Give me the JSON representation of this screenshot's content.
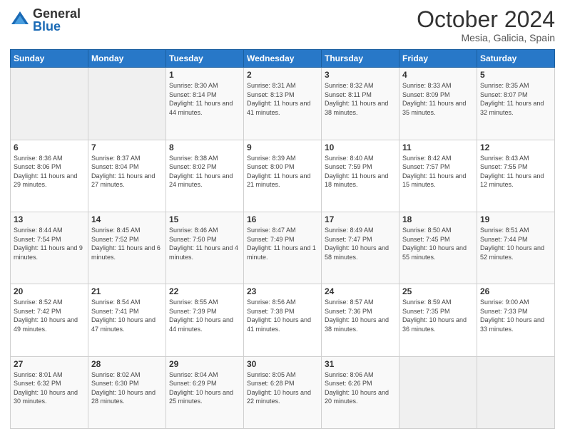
{
  "header": {
    "logo_general": "General",
    "logo_blue": "Blue",
    "month": "October 2024",
    "location": "Mesia, Galicia, Spain"
  },
  "weekdays": [
    "Sunday",
    "Monday",
    "Tuesday",
    "Wednesday",
    "Thursday",
    "Friday",
    "Saturday"
  ],
  "weeks": [
    [
      {
        "day": "",
        "sunrise": "",
        "sunset": "",
        "daylight": ""
      },
      {
        "day": "",
        "sunrise": "",
        "sunset": "",
        "daylight": ""
      },
      {
        "day": "1",
        "sunrise": "Sunrise: 8:30 AM",
        "sunset": "Sunset: 8:14 PM",
        "daylight": "Daylight: 11 hours and 44 minutes."
      },
      {
        "day": "2",
        "sunrise": "Sunrise: 8:31 AM",
        "sunset": "Sunset: 8:13 PM",
        "daylight": "Daylight: 11 hours and 41 minutes."
      },
      {
        "day": "3",
        "sunrise": "Sunrise: 8:32 AM",
        "sunset": "Sunset: 8:11 PM",
        "daylight": "Daylight: 11 hours and 38 minutes."
      },
      {
        "day": "4",
        "sunrise": "Sunrise: 8:33 AM",
        "sunset": "Sunset: 8:09 PM",
        "daylight": "Daylight: 11 hours and 35 minutes."
      },
      {
        "day": "5",
        "sunrise": "Sunrise: 8:35 AM",
        "sunset": "Sunset: 8:07 PM",
        "daylight": "Daylight: 11 hours and 32 minutes."
      }
    ],
    [
      {
        "day": "6",
        "sunrise": "Sunrise: 8:36 AM",
        "sunset": "Sunset: 8:06 PM",
        "daylight": "Daylight: 11 hours and 29 minutes."
      },
      {
        "day": "7",
        "sunrise": "Sunrise: 8:37 AM",
        "sunset": "Sunset: 8:04 PM",
        "daylight": "Daylight: 11 hours and 27 minutes."
      },
      {
        "day": "8",
        "sunrise": "Sunrise: 8:38 AM",
        "sunset": "Sunset: 8:02 PM",
        "daylight": "Daylight: 11 hours and 24 minutes."
      },
      {
        "day": "9",
        "sunrise": "Sunrise: 8:39 AM",
        "sunset": "Sunset: 8:00 PM",
        "daylight": "Daylight: 11 hours and 21 minutes."
      },
      {
        "day": "10",
        "sunrise": "Sunrise: 8:40 AM",
        "sunset": "Sunset: 7:59 PM",
        "daylight": "Daylight: 11 hours and 18 minutes."
      },
      {
        "day": "11",
        "sunrise": "Sunrise: 8:42 AM",
        "sunset": "Sunset: 7:57 PM",
        "daylight": "Daylight: 11 hours and 15 minutes."
      },
      {
        "day": "12",
        "sunrise": "Sunrise: 8:43 AM",
        "sunset": "Sunset: 7:55 PM",
        "daylight": "Daylight: 11 hours and 12 minutes."
      }
    ],
    [
      {
        "day": "13",
        "sunrise": "Sunrise: 8:44 AM",
        "sunset": "Sunset: 7:54 PM",
        "daylight": "Daylight: 11 hours and 9 minutes."
      },
      {
        "day": "14",
        "sunrise": "Sunrise: 8:45 AM",
        "sunset": "Sunset: 7:52 PM",
        "daylight": "Daylight: 11 hours and 6 minutes."
      },
      {
        "day": "15",
        "sunrise": "Sunrise: 8:46 AM",
        "sunset": "Sunset: 7:50 PM",
        "daylight": "Daylight: 11 hours and 4 minutes."
      },
      {
        "day": "16",
        "sunrise": "Sunrise: 8:47 AM",
        "sunset": "Sunset: 7:49 PM",
        "daylight": "Daylight: 11 hours and 1 minute."
      },
      {
        "day": "17",
        "sunrise": "Sunrise: 8:49 AM",
        "sunset": "Sunset: 7:47 PM",
        "daylight": "Daylight: 10 hours and 58 minutes."
      },
      {
        "day": "18",
        "sunrise": "Sunrise: 8:50 AM",
        "sunset": "Sunset: 7:45 PM",
        "daylight": "Daylight: 10 hours and 55 minutes."
      },
      {
        "day": "19",
        "sunrise": "Sunrise: 8:51 AM",
        "sunset": "Sunset: 7:44 PM",
        "daylight": "Daylight: 10 hours and 52 minutes."
      }
    ],
    [
      {
        "day": "20",
        "sunrise": "Sunrise: 8:52 AM",
        "sunset": "Sunset: 7:42 PM",
        "daylight": "Daylight: 10 hours and 49 minutes."
      },
      {
        "day": "21",
        "sunrise": "Sunrise: 8:54 AM",
        "sunset": "Sunset: 7:41 PM",
        "daylight": "Daylight: 10 hours and 47 minutes."
      },
      {
        "day": "22",
        "sunrise": "Sunrise: 8:55 AM",
        "sunset": "Sunset: 7:39 PM",
        "daylight": "Daylight: 10 hours and 44 minutes."
      },
      {
        "day": "23",
        "sunrise": "Sunrise: 8:56 AM",
        "sunset": "Sunset: 7:38 PM",
        "daylight": "Daylight: 10 hours and 41 minutes."
      },
      {
        "day": "24",
        "sunrise": "Sunrise: 8:57 AM",
        "sunset": "Sunset: 7:36 PM",
        "daylight": "Daylight: 10 hours and 38 minutes."
      },
      {
        "day": "25",
        "sunrise": "Sunrise: 8:59 AM",
        "sunset": "Sunset: 7:35 PM",
        "daylight": "Daylight: 10 hours and 36 minutes."
      },
      {
        "day": "26",
        "sunrise": "Sunrise: 9:00 AM",
        "sunset": "Sunset: 7:33 PM",
        "daylight": "Daylight: 10 hours and 33 minutes."
      }
    ],
    [
      {
        "day": "27",
        "sunrise": "Sunrise: 8:01 AM",
        "sunset": "Sunset: 6:32 PM",
        "daylight": "Daylight: 10 hours and 30 minutes."
      },
      {
        "day": "28",
        "sunrise": "Sunrise: 8:02 AM",
        "sunset": "Sunset: 6:30 PM",
        "daylight": "Daylight: 10 hours and 28 minutes."
      },
      {
        "day": "29",
        "sunrise": "Sunrise: 8:04 AM",
        "sunset": "Sunset: 6:29 PM",
        "daylight": "Daylight: 10 hours and 25 minutes."
      },
      {
        "day": "30",
        "sunrise": "Sunrise: 8:05 AM",
        "sunset": "Sunset: 6:28 PM",
        "daylight": "Daylight: 10 hours and 22 minutes."
      },
      {
        "day": "31",
        "sunrise": "Sunrise: 8:06 AM",
        "sunset": "Sunset: 6:26 PM",
        "daylight": "Daylight: 10 hours and 20 minutes."
      },
      {
        "day": "",
        "sunrise": "",
        "sunset": "",
        "daylight": ""
      },
      {
        "day": "",
        "sunrise": "",
        "sunset": "",
        "daylight": ""
      }
    ]
  ]
}
